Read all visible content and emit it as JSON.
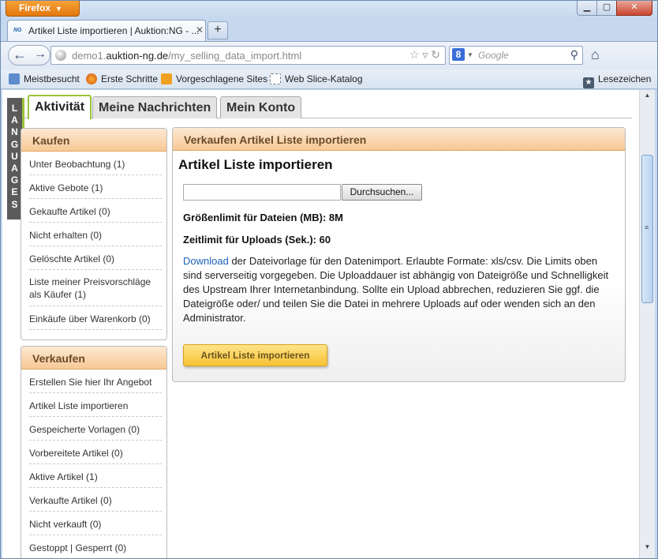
{
  "browser": {
    "menu_button": "Firefox",
    "tab_title": "Artikel Liste importieren | Auktion:NG - ...",
    "tab_favicon": "NG",
    "url_prefix": "demo1.",
    "url_domain": "auktion-ng.de",
    "url_path": "/my_selling_data_import.html",
    "search_engine_icon": "8",
    "search_placeholder": "Google",
    "bookmarks": [
      "Meistbesucht",
      "Erste Schritte",
      "Vorgeschlagene Sites",
      "Web Slice-Katalog"
    ],
    "bookmarks_menu": "Lesezeichen"
  },
  "page": {
    "languages_tab": [
      "L",
      "A",
      "N",
      "G",
      "U",
      "A",
      "G",
      "E",
      "S"
    ],
    "tabs": [
      "Aktivität",
      "Meine Nachrichten",
      "Mein Konto"
    ],
    "sidebar": {
      "buy_title": "Kaufen",
      "buy_items": [
        "Unter Beobachtung (1)",
        "Aktive Gebote (1)",
        "Gekaufte Artikel (0)",
        "Nicht erhalten (0)",
        "Gelöschte Artikel (0)",
        "Liste meiner Preisvorschläge als Käufer (1)",
        "Einkäufe über Warenkorb (0)"
      ],
      "sell_title": "Verkaufen",
      "sell_items": [
        "Erstellen Sie hier Ihr Angebot",
        "Artikel Liste importieren",
        "Gespeicherte Vorlagen (0)",
        "Vorbereitete Artikel (0)",
        "Aktive Artikel (1)",
        "Verkaufte Artikel (0)",
        "Nicht verkauft (0)",
        "Gestoppt | Gesperrt (0)"
      ]
    },
    "main": {
      "box_title": "Verkaufen Artikel Liste importieren",
      "heading": "Artikel Liste importieren",
      "browse_button": "Durchsuchen...",
      "size_limit": "Größenlimit für Dateien (MB): 8M",
      "time_limit": "Zeitlimit für Uploads (Sek.): 60",
      "download_link": "Download",
      "description": " der Dateivorlage für den Datenimport. Erlaubte Formate: xls/csv. Die Limits oben sind serverseitig vorgegeben. Die Uploaddauer ist abhängig von Dateigröße und Schnelligkeit des Upstream Ihrer Internetanbindung. Sollte ein Upload abbrechen, reduzieren Sie ggf. die Dateigröße oder/ und teilen Sie die Datei in mehrere Uploads auf oder wenden sich an den Administrator.",
      "import_button": "Artikel Liste importieren"
    }
  }
}
